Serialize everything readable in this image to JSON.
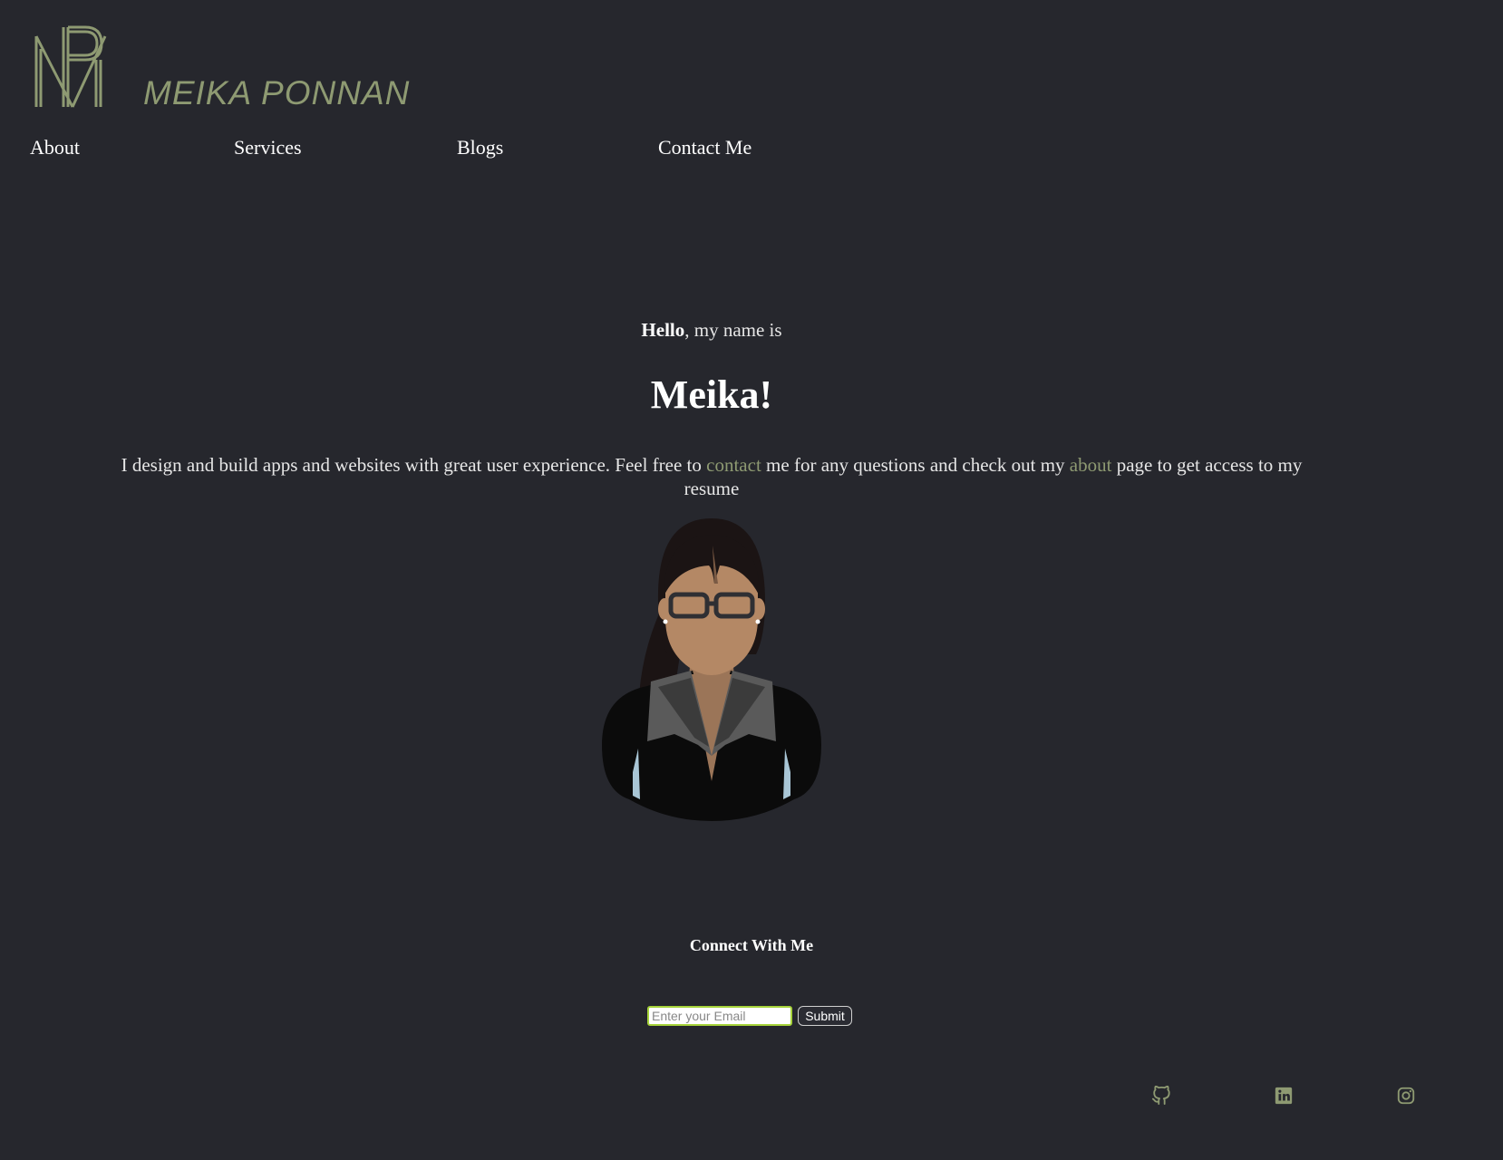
{
  "header": {
    "logo_icon": "mp-monogram-logo",
    "brand_name": "MEIKA PONNAN"
  },
  "nav": {
    "items": [
      {
        "label": "About"
      },
      {
        "label": "Services"
      },
      {
        "label": "Blogs"
      },
      {
        "label": "Contact Me"
      }
    ]
  },
  "hero": {
    "greeting_bold": "Hello",
    "greeting_rest": ", my name is",
    "name": "Meika!",
    "intro_part1": "I design and build apps and websites with great user experience. Feel free to ",
    "intro_link_contact": "contact",
    "intro_part2": " me for any questions and check out my ",
    "intro_link_about": "about",
    "intro_part3": " page to get access to my resume",
    "avatar_icon": "woman-avatar-illustration"
  },
  "connect": {
    "title": "Connect With Me",
    "email_placeholder": "Enter your Email",
    "email_value": "",
    "submit_label": "Submit"
  },
  "social": {
    "icons": [
      "github-icon",
      "linkedin-icon",
      "instagram-icon"
    ]
  },
  "colors": {
    "background": "#26272d",
    "accent": "#8e9a72",
    "text": "#ffffff",
    "input_border": "#a6d33a"
  }
}
